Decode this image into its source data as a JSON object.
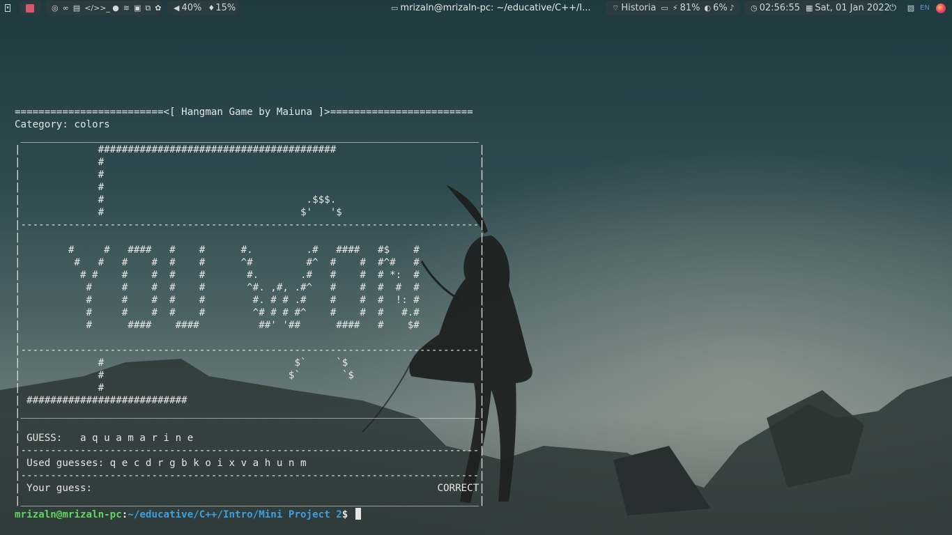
{
  "topbar": {
    "left_icons": [
      "menu-icon",
      "stop-icon"
    ],
    "app_icons": [
      "chrome-icon",
      "gamepad-icon",
      "document-icon",
      "code-icon",
      "terminal-icon",
      "chat-icon",
      "spotify-icon",
      "image-icon",
      "window-icon",
      "settings-icon"
    ],
    "volume": "40%",
    "mic": "15%",
    "window_title": "mrizaln@mrizaln-pc: ~/educative/C++/I...",
    "wifi": "Historia",
    "battery": "81%",
    "brightness": "6%",
    "time": "02:56:55",
    "date": "Sat, 01 Jan 2022",
    "lang": "EN"
  },
  "terminal": {
    "lines": [
      "=========================<[ Hangman Game by Maiuna ]>========================",
      "Category: colors",
      "",
      "|             ########################################                        |",
      "|             #                                                               |",
      "|             #                                                               |",
      "|             #                                                               |",
      "|             #                                  .$$$.                        |",
      "|             #                                 $'   '$                       |",
      "|-----------------------------------------------------------------------------|",
      "|                                                                             |",
      "|        #     #   ####   #    #      #.         .#   ####   #$    #          |",
      "|         #   #   #    #  #    #      ^#         #^  #    #  #^#   #          |",
      "|          # #    #    #  #    #       #.       .#   #    #  # *:  #          |",
      "|           #     #    #  #    #       ^#. ,#, .#^   #    #  #  #  #          |",
      "|           #     #    #  #    #        #. # # .#    #    #  #  !: #          |",
      "|           #     #    #  #    #        ^# # # #^    #    #  #   #.#          |",
      "|           #      ####    ####          ##' '##      ####   #    $#          |",
      "|                                                                             |",
      "|-----------------------------------------------------------------------------|",
      "|             #                                $`     `$                      |",
      "|             #                               $`       `$                     |",
      "|             #                                                               |",
      "| ###########################                                                 |",
      "|_____________________________________________________________________________|",
      "|                                                                             |",
      "| GUESS:   a q u a m a r i n e                                                |",
      "|-----------------------------------------------------------------------------|",
      "| Used guesses: q e c d r g b k o i x v a h u n m                             |",
      "|-----------------------------------------------------------------------------|",
      "| Your guess:                                                          CORRECT|",
      "|_____________________________________________________________________________|"
    ],
    "top_rule": " _____________________________________________________________________________ ",
    "prompt_user": "mrizaln@mrizaln-pc",
    "prompt_sep": ":",
    "prompt_path": "~/educative/C++/Intro/Mini Project 2",
    "prompt_dollar": "$ "
  }
}
